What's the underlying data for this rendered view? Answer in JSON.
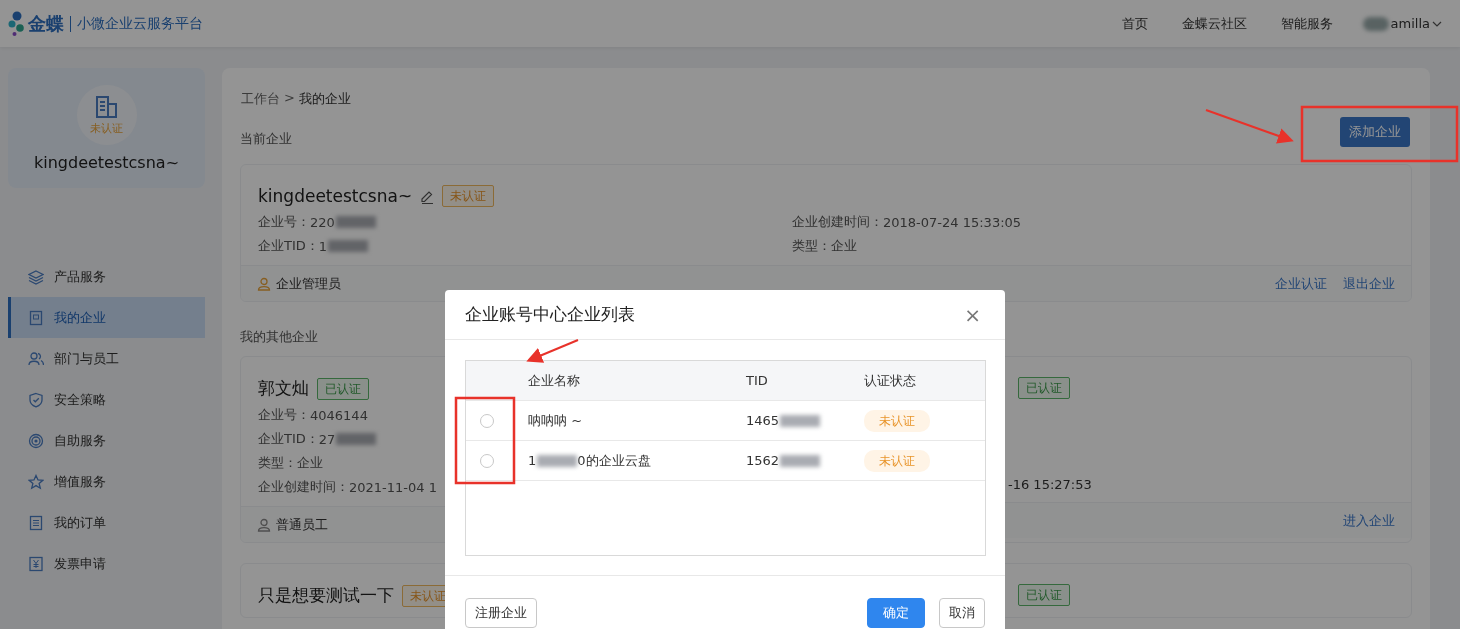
{
  "header": {
    "brand": "金蝶",
    "product": "小微企业云服务平台",
    "nav": [
      "首页",
      "金蝶云社区",
      "智能服务"
    ],
    "user": "amilla"
  },
  "sidebar": {
    "badge": "未认证",
    "company": "kingdeetestcsna~",
    "items": [
      {
        "label": "产品服务",
        "selected": false
      },
      {
        "label": "我的企业",
        "selected": true
      },
      {
        "label": "部门与员工",
        "selected": false
      },
      {
        "label": "安全策略",
        "selected": false
      },
      {
        "label": "自助服务",
        "selected": false
      },
      {
        "label": "增值服务",
        "selected": false
      },
      {
        "label": "我的订单",
        "selected": false
      },
      {
        "label": "发票申请",
        "selected": false
      }
    ]
  },
  "breadcrumb": {
    "parent": "工作台",
    "separator": ">",
    "current": "我的企业"
  },
  "current_section": "当前企业",
  "add_button": "添加企业",
  "current_company": {
    "name": "kingdeetestcsna~",
    "status": {
      "label": "未认证",
      "kind": "unverified"
    },
    "left_fields": [
      {
        "label": "企业号：",
        "value": [
          "220"
        ],
        "blur_end": true
      },
      {
        "label": "企业TID：",
        "value": [
          "1"
        ],
        "blur_end": true
      }
    ],
    "right_fields": [
      {
        "label": "企业创建时间：",
        "value": [
          "2018-07-24 15:33:05"
        ],
        "blur_end": false
      },
      {
        "label": "类型：",
        "value": [
          "企业"
        ],
        "blur_end": false
      }
    ],
    "role": "企业管理员",
    "actions": [
      "企业认证",
      "退出企业"
    ]
  },
  "other_section": "我的其他企业",
  "other_companies": [
    {
      "name": "郭文灿",
      "status": {
        "label": "已认证",
        "kind": "verified"
      },
      "fields": [
        {
          "label": "企业号：",
          "value": [
            "4046144"
          ],
          "blur_end": false
        },
        {
          "label": "企业TID：",
          "value": [
            "27"
          ],
          "blur_end": true
        },
        {
          "label": "类型：",
          "value": [
            "企业"
          ],
          "blur_end": false
        },
        {
          "label": "企业创建时间：",
          "value": [
            "2021-11-04 1"
          ],
          "blur_end": false
        }
      ],
      "role": "普通员工"
    },
    {
      "status": {
        "label": "已认证",
        "kind": "verified"
      },
      "time_tail": "-16 15:27:53",
      "action": "进入企业"
    },
    {
      "name": "只是想要测试一下",
      "status": {
        "label": "未认证",
        "kind": "unverified"
      }
    },
    {
      "status": {
        "label": "已认证",
        "kind": "verified"
      }
    }
  ],
  "dialog": {
    "title": "企业账号中心企业列表",
    "close": "×",
    "columns": [
      "企业名称",
      "TID",
      "认证状态"
    ],
    "rows": [
      {
        "selected": false,
        "name": [
          "呐呐呐 ~"
        ],
        "tid": [
          "1465"
        ],
        "status": {
          "label": "未认证",
          "kind": "unverified"
        }
      },
      {
        "selected": false,
        "name": [
          "1",
          "0的企业云盘"
        ],
        "tid": [
          "1562"
        ],
        "status": {
          "label": "未认证",
          "kind": "unverified"
        }
      }
    ],
    "register_button": "注册企业",
    "ok_button": "确定",
    "cancel_button": "取消"
  }
}
